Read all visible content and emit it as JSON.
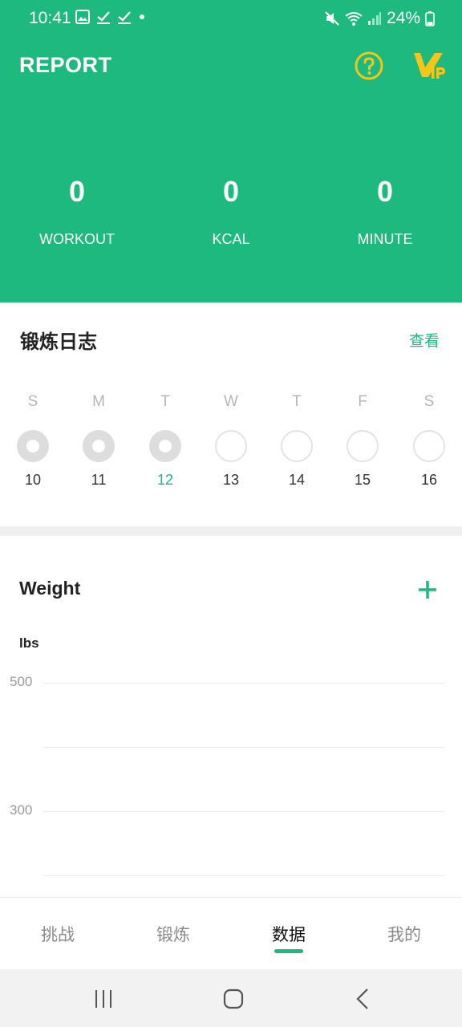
{
  "status_bar": {
    "time": "10:41",
    "battery": "24%"
  },
  "header": {
    "title": "REPORT",
    "accent_color": "#1db97e",
    "vip_color": "#f5c518",
    "stats": [
      {
        "value": "0",
        "label": "WORKOUT"
      },
      {
        "value": "0",
        "label": "KCAL"
      },
      {
        "value": "0",
        "label": "MINUTE"
      }
    ]
  },
  "workout_log": {
    "title": "锻炼日志",
    "view_label": "查看",
    "days": [
      {
        "dow": "S",
        "date": "10",
        "done": true,
        "today": false
      },
      {
        "dow": "M",
        "date": "11",
        "done": true,
        "today": false
      },
      {
        "dow": "T",
        "date": "12",
        "done": true,
        "today": true
      },
      {
        "dow": "W",
        "date": "13",
        "done": false,
        "today": false
      },
      {
        "dow": "T",
        "date": "14",
        "done": false,
        "today": false
      },
      {
        "dow": "F",
        "date": "15",
        "done": false,
        "today": false
      },
      {
        "dow": "S",
        "date": "16",
        "done": false,
        "today": false
      }
    ]
  },
  "weight": {
    "title": "Weight",
    "unit": "lbs",
    "y_ticks": [
      "500",
      "300"
    ]
  },
  "tabs": [
    {
      "label": "挑战",
      "active": false
    },
    {
      "label": "锻炼",
      "active": false
    },
    {
      "label": "数据",
      "active": true
    },
    {
      "label": "我的",
      "active": false
    }
  ],
  "icons": {
    "help": "help-circle-icon",
    "vip": "vip-icon",
    "add": "plus-icon"
  }
}
